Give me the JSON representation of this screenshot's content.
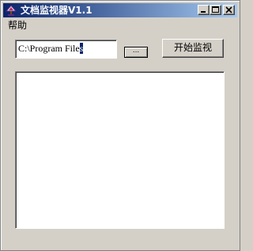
{
  "window": {
    "title": "文档监视器V1.1",
    "app_icon": "app-icon",
    "caption_buttons": [
      "minimize-icon",
      "maximize-icon",
      "close-icon"
    ]
  },
  "menu": {
    "items": [
      {
        "label": "帮助"
      }
    ]
  },
  "path_field": {
    "value_before_selection": "C:\\Program File",
    "selected_text": "s"
  },
  "browse_button": {
    "label": "..."
  },
  "start_button": {
    "label": "开始监视"
  },
  "log": {
    "lines": []
  },
  "colors": {
    "titlebar_start": "#0a246a",
    "titlebar_end": "#a6caf0",
    "face": "#d4d0c8",
    "selection": "#0a246a"
  }
}
